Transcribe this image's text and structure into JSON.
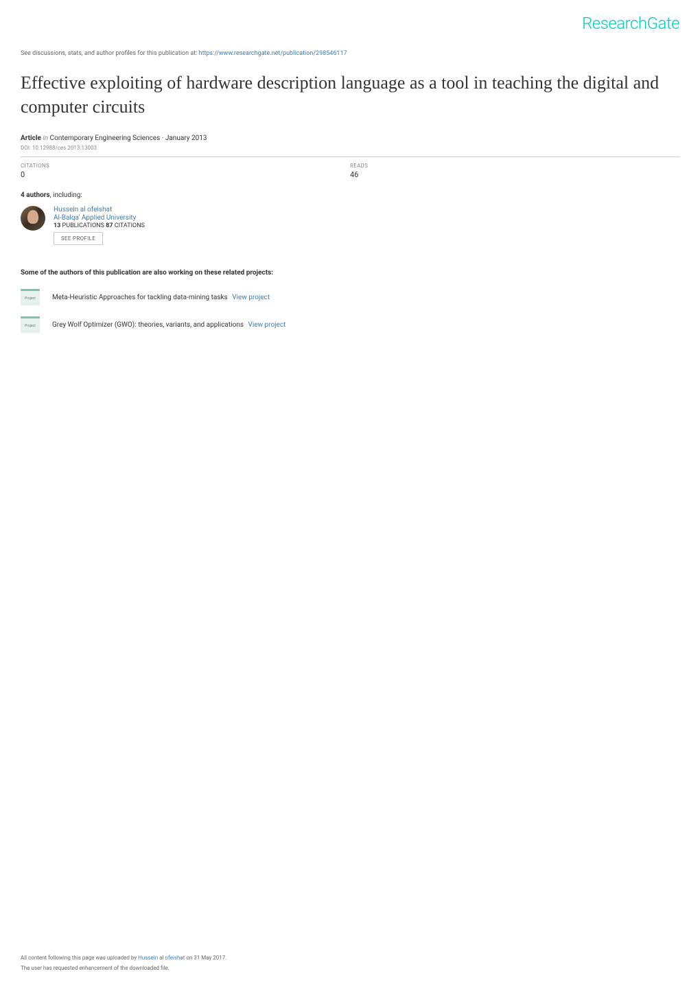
{
  "header": {
    "logo": "ResearchGate"
  },
  "discussion": {
    "prefix": "See discussions, stats, and author profiles for this publication at: ",
    "url": "https://www.researchgate.net/publication/298546117"
  },
  "title": "Effective exploiting of hardware description language as a tool in teaching the digital and computer circuits",
  "article_meta": {
    "label": "Article",
    "in_label": "in",
    "journal": "Contemporary Engineering Sciences · January 2013"
  },
  "doi": "DOI: 10.12988/ces.2013.13003",
  "stats": {
    "citations": {
      "label": "CITATIONS",
      "value": "0"
    },
    "reads": {
      "label": "READS",
      "value": "46"
    }
  },
  "authors_heading": {
    "count": "4 authors",
    "suffix": ", including:"
  },
  "author": {
    "name": "Hussein al ofeishat",
    "affiliation": "Al-Balqa' Applied University",
    "pubs_num": "13",
    "pubs_label": " PUBLICATIONS   ",
    "cites_num": "87",
    "cites_label": " CITATIONS",
    "see_profile": "SEE PROFILE"
  },
  "related": {
    "heading": "Some of the authors of this publication are also working on these related projects:",
    "icon_label": "Project",
    "view_label": "View project",
    "projects": [
      {
        "title": "Meta-Heuristic Approaches for tackling data-mining tasks"
      },
      {
        "title": "Grey Wolf Optimizer (GWO): theories, variants, and applications"
      }
    ]
  },
  "footer": {
    "line1_prefix": "All content following this page was uploaded by ",
    "line1_author": "Hussein al ofeishat",
    "line1_suffix": " on 31 May 2017.",
    "line2": "The user has requested enhancement of the downloaded file."
  }
}
